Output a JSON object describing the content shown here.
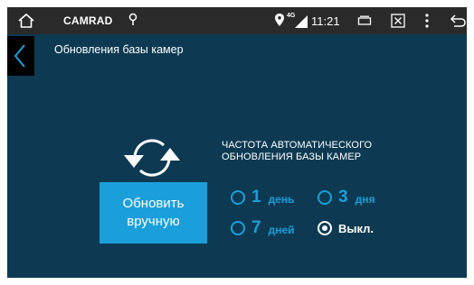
{
  "status_bar": {
    "app_name": "CAMRAD",
    "network_label": "4G",
    "time": "11:21",
    "icons": [
      "home-icon",
      "gps-pin-icon",
      "location-icon",
      "signal-icon",
      "window-icon",
      "screenshot-icon",
      "overflow-menu-icon",
      "back-icon"
    ]
  },
  "header": {
    "title": "Обновления базы камер",
    "back_icon": "chevron-left-icon"
  },
  "main": {
    "update_button": {
      "line1": "Обновить",
      "line2": "вручную"
    },
    "frequency": {
      "heading_line1": "ЧАСТОТА АВТОМАТИЧЕСКОГО",
      "heading_line2": "ОБНОВЛЕНИЯ БАЗЫ КАМЕР",
      "options": [
        {
          "number": "1",
          "unit": "день",
          "selected": false
        },
        {
          "number": "3",
          "unit": "дня",
          "selected": false
        },
        {
          "number": "7",
          "unit": "дней",
          "selected": false
        },
        {
          "label": "Выкл.",
          "selected": true
        }
      ]
    }
  },
  "colors": {
    "background": "#0d3a52",
    "status_bar": "#2a2a2a",
    "accent": "#1b9fdb",
    "text": "#ffffff"
  }
}
